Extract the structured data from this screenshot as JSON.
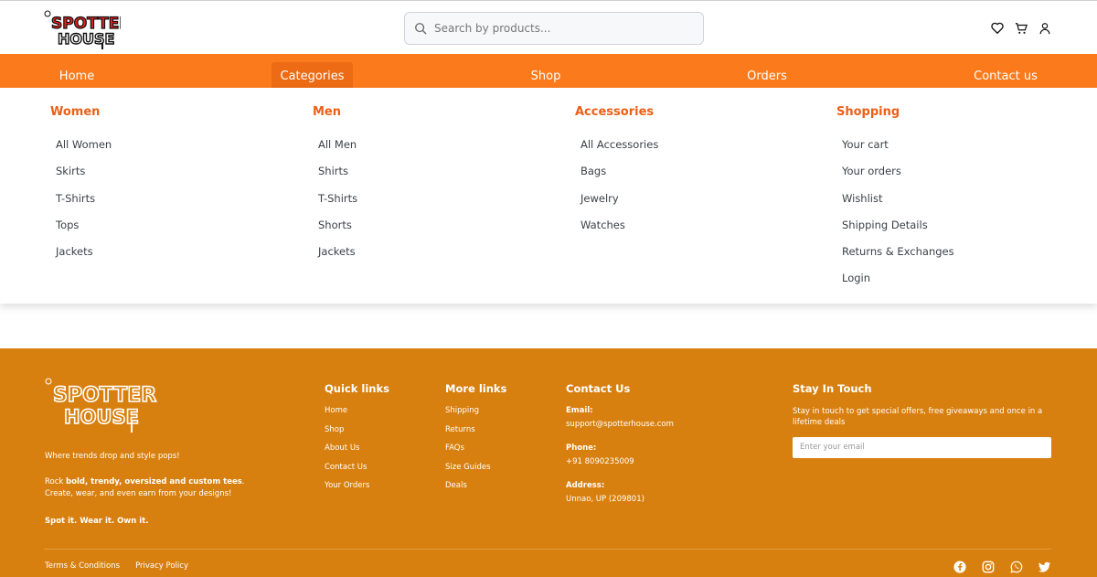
{
  "brand": {
    "name_line1": "SPOTTER",
    "name_line2": "HOUSE",
    "accent": "#fb7b1c",
    "footer_bg": "#d8800f",
    "title_color": "#ec5f17"
  },
  "search": {
    "placeholder": "Search by products..."
  },
  "header_icons": [
    "heart-icon",
    "cart-icon",
    "user-icon"
  ],
  "nav": {
    "items": [
      {
        "label": "Home"
      },
      {
        "label": "Categories",
        "active": true
      },
      {
        "label": "Shop"
      },
      {
        "label": "Orders"
      },
      {
        "label": "Contact us"
      }
    ]
  },
  "mega_menu": {
    "columns": [
      {
        "title": "Women",
        "items": [
          "All Women",
          "Skirts",
          "T-Shirts",
          "Tops",
          "Jackets"
        ]
      },
      {
        "title": "Men",
        "items": [
          "All Men",
          "Shirts",
          "T-Shirts",
          "Shorts",
          "Jackets"
        ]
      },
      {
        "title": "Accessories",
        "items": [
          "All Accessories",
          "Bags",
          "Jewelry",
          "Watches"
        ]
      },
      {
        "title": "Shopping",
        "items": [
          "Your cart",
          "Your orders",
          "Wishlist",
          "Shipping Details",
          "Returns & Exchanges",
          "Login"
        ]
      }
    ]
  },
  "footer": {
    "tagline": "Where trends drop and style pops!",
    "desc_prefix": "Rock ",
    "desc_bold": "bold, trendy, oversized and custom tees",
    "desc_suffix": ".",
    "desc_line2": "Create, wear, and even earn from your designs!",
    "motto": "Spot it. Wear it. Own it.",
    "quick_links": {
      "title": "Quick links",
      "items": [
        "Home",
        "Shop",
        "About Us",
        "Contact Us",
        "Your Orders"
      ]
    },
    "more_links": {
      "title": "More links",
      "items": [
        "Shipping",
        "Returns",
        "FAQs",
        "Size Guides",
        "Deals"
      ]
    },
    "contact": {
      "title": "Contact Us",
      "email_label": "Email:",
      "email": "support@spotterhouse.com",
      "phone_label": "Phone:",
      "phone": "+91 8090235009",
      "address_label": "Address:",
      "address": "Unnao, UP (209801)"
    },
    "stay": {
      "title": "Stay In Touch",
      "desc": "Stay in touch to get special offers, free giveaways and once in a lifetime deals",
      "email_placeholder": "Enter your email"
    },
    "bottom_links": [
      "Terms & Conditions",
      "Privacy Policy"
    ],
    "socials": [
      "facebook-icon",
      "instagram-icon",
      "whatsapp-icon",
      "twitter-icon"
    ]
  }
}
